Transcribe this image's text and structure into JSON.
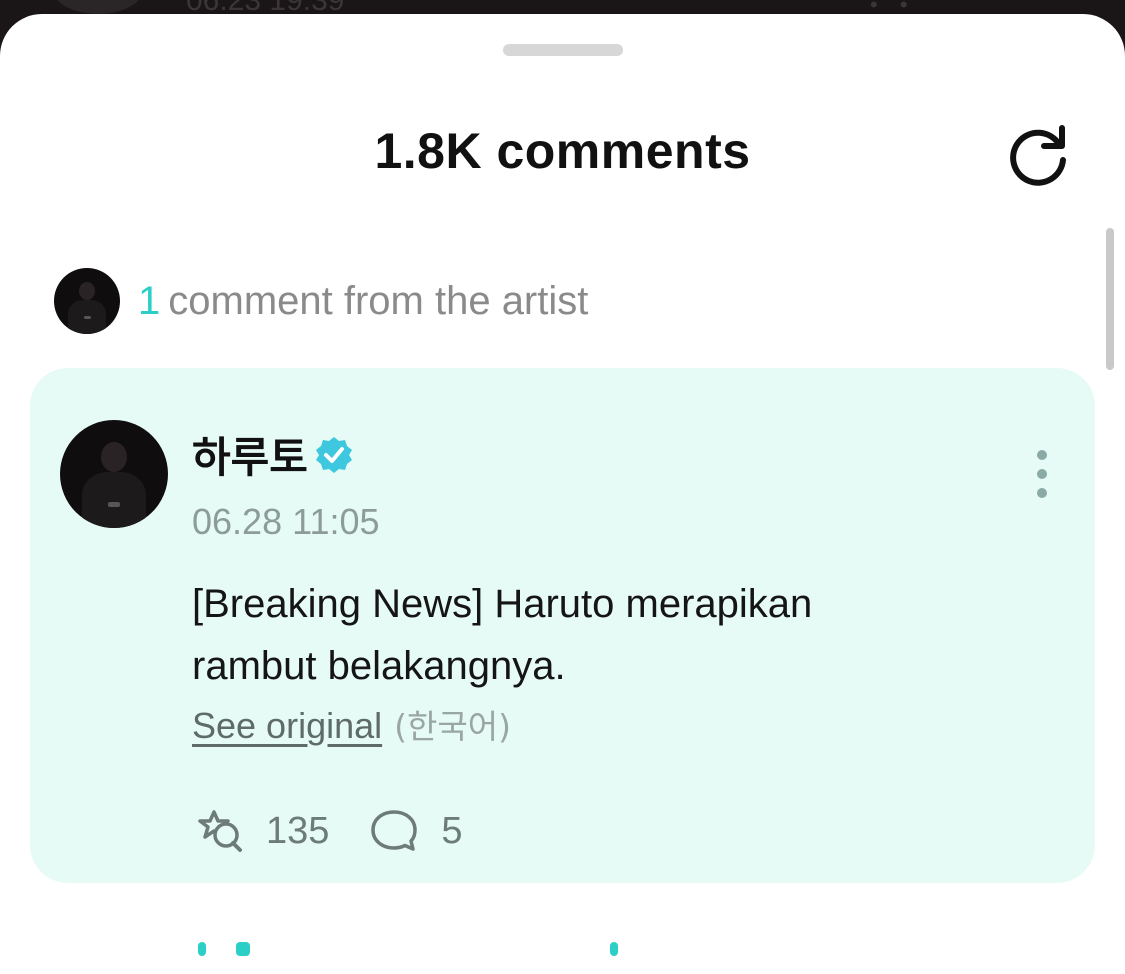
{
  "background": {
    "timestamp": "06.23 19:39"
  },
  "sheet": {
    "title": "1.8K comments",
    "refresh_icon": "refresh-icon"
  },
  "artist_summary": {
    "count": "1",
    "label": "comment from the artist"
  },
  "comment": {
    "author": "하루토",
    "verified_icon": "verified-badge-icon",
    "timestamp": "06.28 11:05",
    "text_lines": [
      "[Breaking News] Haruto merapikan",
      "rambut belakangnya."
    ],
    "see_original": "See original",
    "original_language": "(한국어)",
    "reactions": {
      "icon": "reaction-icon",
      "count": "135"
    },
    "replies": {
      "icon": "reply-bubble-icon",
      "count": "5"
    },
    "more_icon": "more-vertical-icon"
  },
  "colors": {
    "accent": "#2ccfc6",
    "card_background": "#e7fbf6",
    "verified": "#3ec8e0"
  }
}
